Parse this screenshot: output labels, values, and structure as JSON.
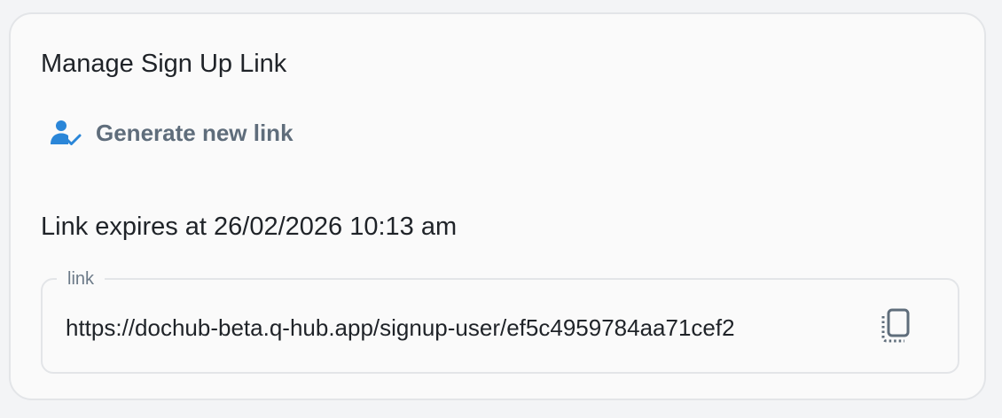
{
  "card": {
    "title": "Manage Sign Up Link",
    "generate_button": {
      "label": "Generate new link",
      "icon": "user-check-icon"
    },
    "expiry": {
      "prefix": "Link expires at",
      "datetime": "26/02/2026 10:13 am"
    },
    "link_field": {
      "label": "link",
      "value": "https://dochub-beta.q-hub.app/signup-user/ef5c4959784aa71cef2",
      "copy_icon": "copy-icon"
    }
  },
  "colors": {
    "accent": "#2a86d8",
    "button_text": "#5f6d7b",
    "text": "#1f2328",
    "border": "#e3e5e8",
    "background": "#fafafa"
  }
}
